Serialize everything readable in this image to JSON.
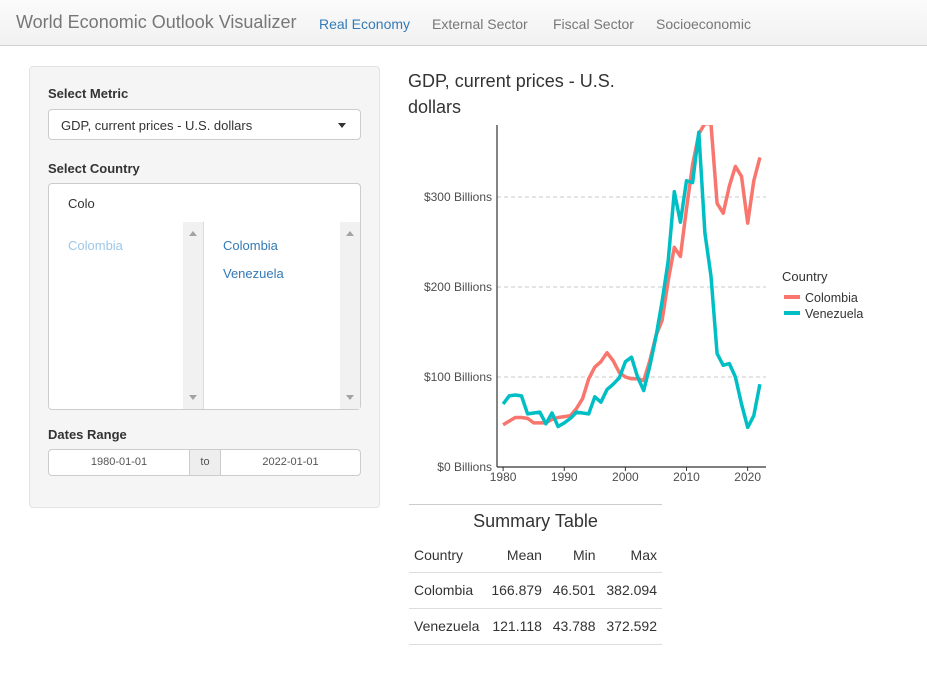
{
  "navbar": {
    "brand": "World Economic Outlook Visualizer",
    "tabs": [
      {
        "label": "Real Economy",
        "active": true
      },
      {
        "label": "External Sector",
        "active": false
      },
      {
        "label": "Fiscal Sector",
        "active": false
      },
      {
        "label": "Socioeconomic",
        "active": false
      }
    ]
  },
  "sidebar": {
    "metric_label": "Select Metric",
    "metric_value": "GDP, current prices - U.S. dollars",
    "country_label": "Select Country",
    "country_search": "Colo",
    "available_options": [
      "Colombia"
    ],
    "selected_options": [
      "Colombia",
      "Venezuela"
    ],
    "dates_label": "Dates Range",
    "date_start": "1980-01-01",
    "date_sep": "to",
    "date_end": "2022-01-01"
  },
  "chart_data": {
    "type": "line",
    "title": "GDP, current prices - U.S. dollars",
    "xlabel": "",
    "ylabel": "",
    "xlim": [
      1979,
      2023
    ],
    "ylim": [
      0,
      380
    ],
    "x_ticks": [
      1980,
      1990,
      2000,
      2010,
      2020
    ],
    "y_ticks": [
      0,
      100,
      200,
      300
    ],
    "y_tick_labels": [
      "$0 Billions",
      "$100 Billions",
      "$200 Billions",
      "$300 Billions"
    ],
    "grid": "horizontal-dashed",
    "legend_title": "Country",
    "legend_position": "right",
    "x": [
      1980,
      1981,
      1982,
      1983,
      1984,
      1985,
      1986,
      1987,
      1988,
      1989,
      1990,
      1991,
      1992,
      1993,
      1994,
      1995,
      1996,
      1997,
      1998,
      1999,
      2000,
      2001,
      2002,
      2003,
      2004,
      2005,
      2006,
      2007,
      2008,
      2009,
      2010,
      2011,
      2012,
      2013,
      2014,
      2015,
      2016,
      2017,
      2018,
      2019,
      2020,
      2021,
      2022
    ],
    "series": [
      {
        "name": "Colombia",
        "color": "#f8766d",
        "values": [
          47,
          51,
          55,
          55,
          54,
          49,
          49,
          49,
          53,
          55,
          56,
          57,
          65,
          76,
          98,
          111,
          117,
          127,
          118,
          105,
          100,
          98,
          98,
          96,
          118,
          146,
          163,
          207,
          244,
          234,
          287,
          336,
          370,
          382,
          381,
          293,
          282,
          312,
          334,
          323,
          271,
          318,
          344
        ]
      },
      {
        "name": "Venezuela",
        "color": "#00bfc4",
        "values": [
          70,
          79,
          80,
          79,
          59,
          60,
          61,
          48,
          60,
          45,
          49,
          54,
          61,
          60,
          59,
          78,
          72,
          86,
          92,
          99,
          117,
          122,
          100,
          85,
          112,
          145,
          184,
          229,
          306,
          272,
          318,
          316,
          372,
          260,
          212,
          126,
          113,
          115,
          100,
          70,
          44,
          57,
          92
        ]
      }
    ]
  },
  "summary": {
    "caption": "Summary Table",
    "headers": [
      "Country",
      "Mean",
      "Min",
      "Max"
    ],
    "rows": [
      [
        "Colombia",
        "166.879",
        "46.501",
        "382.094"
      ],
      [
        "Venezuela",
        "121.118",
        "43.788",
        "372.592"
      ]
    ]
  }
}
